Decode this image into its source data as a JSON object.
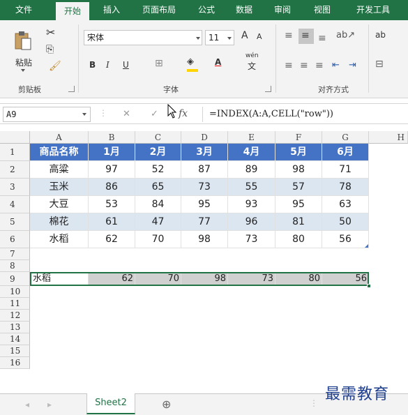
{
  "ribbon_tabs": [
    "文件",
    "开始",
    "插入",
    "页面布局",
    "公式",
    "数据",
    "审阅",
    "视图",
    "开发工具"
  ],
  "active_tab": "开始",
  "clipboard": {
    "paste_label": "粘贴",
    "group_label": "剪贴板"
  },
  "font": {
    "name": "宋体",
    "size": "11",
    "group_label": "字体",
    "bold": "B",
    "italic": "I",
    "underline": "U",
    "grow": "A",
    "shrink": "A",
    "phonetic_top": "wén",
    "phonetic_bottom": "文",
    "font_color_glyph": "A"
  },
  "alignment": {
    "group_label": "对齐方式",
    "wrap_glyph": "ab"
  },
  "formula_bar": {
    "name_box": "A9",
    "formula": "=INDEX(A:A,CELL(\"row\"))",
    "fx": "fx",
    "cancel": "✕",
    "enter": "✓"
  },
  "columns": [
    "A",
    "B",
    "C",
    "D",
    "E",
    "F",
    "G",
    "H"
  ],
  "rows": [
    "1",
    "2",
    "3",
    "4",
    "5",
    "6",
    "7",
    "8",
    "9",
    "10",
    "11",
    "12",
    "13",
    "14",
    "15",
    "16"
  ],
  "table": {
    "header": [
      "商品名称",
      "1月",
      "2月",
      "3月",
      "4月",
      "5月",
      "6月"
    ],
    "body": [
      [
        "高粱",
        "97",
        "52",
        "87",
        "89",
        "98",
        "71"
      ],
      [
        "玉米",
        "86",
        "65",
        "73",
        "55",
        "57",
        "78"
      ],
      [
        "大豆",
        "53",
        "84",
        "95",
        "93",
        "95",
        "63"
      ],
      [
        "棉花",
        "61",
        "47",
        "77",
        "96",
        "81",
        "50"
      ],
      [
        "水稻",
        "62",
        "70",
        "98",
        "73",
        "80",
        "56"
      ]
    ]
  },
  "row9": [
    "水稻",
    "62",
    "70",
    "98",
    "73",
    "80",
    "56"
  ],
  "sheet_tab": "Sheet2",
  "add_sheet": "⊕",
  "watermark": "最需教育",
  "colors": {
    "brand": "#217346",
    "table_header": "#4472c4",
    "band": "#dce6f1",
    "row9_fill": "#d0d0d0"
  }
}
